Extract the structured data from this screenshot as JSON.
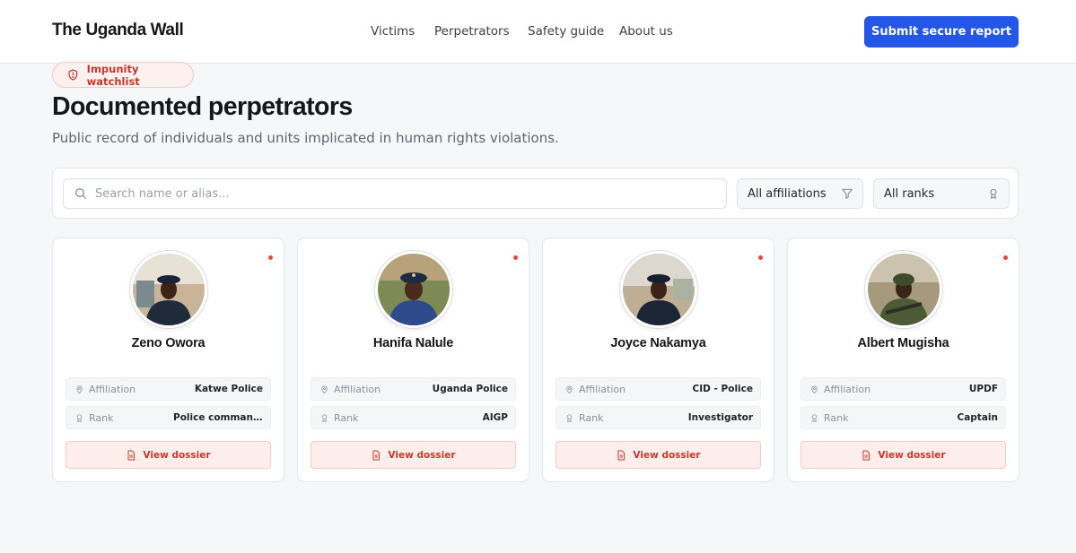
{
  "header": {
    "brand": "The Uganda Wall",
    "nav": [
      {
        "label": "Victims"
      },
      {
        "label": "Perpetrators"
      },
      {
        "label": "Safety guide"
      },
      {
        "label": "About us"
      }
    ],
    "cta_label": "Submit secure report"
  },
  "hero": {
    "badge": "Impunity watchlist",
    "title": "Documented perpetrators",
    "subtitle": "Public record of individuals and units implicated in human rights violations."
  },
  "filters": {
    "search_placeholder": "Search name or alias...",
    "affiliation_selected": "All affiliations",
    "rank_selected": "All ranks"
  },
  "cards": [
    {
      "name": "Zeno Owora",
      "affiliation": "Katwe Police",
      "rank": "Police commander"
    },
    {
      "name": "Hanifa Nalule",
      "affiliation": "Uganda Police",
      "rank": "AIGP"
    },
    {
      "name": "Joyce Nakamya",
      "affiliation": "CID - Police",
      "rank": "Investigator"
    },
    {
      "name": "Albert Mugisha",
      "affiliation": "UPDF",
      "rank": "Captain"
    }
  ],
  "labels": {
    "affiliation": "Affiliation",
    "rank": "Rank",
    "view_dossier": "View dossier"
  },
  "colors": {
    "accent": "#2457e8",
    "alert": "#c2392b",
    "status_dot": "#e0483a"
  },
  "icons": {
    "badge": "shield-alert-icon",
    "search": "search-icon",
    "affiliation_select": "filter-icon",
    "rank_select": "award-icon",
    "affiliation_row": "map-pin-icon",
    "rank_row": "award-icon",
    "dossier": "file-text-icon"
  }
}
